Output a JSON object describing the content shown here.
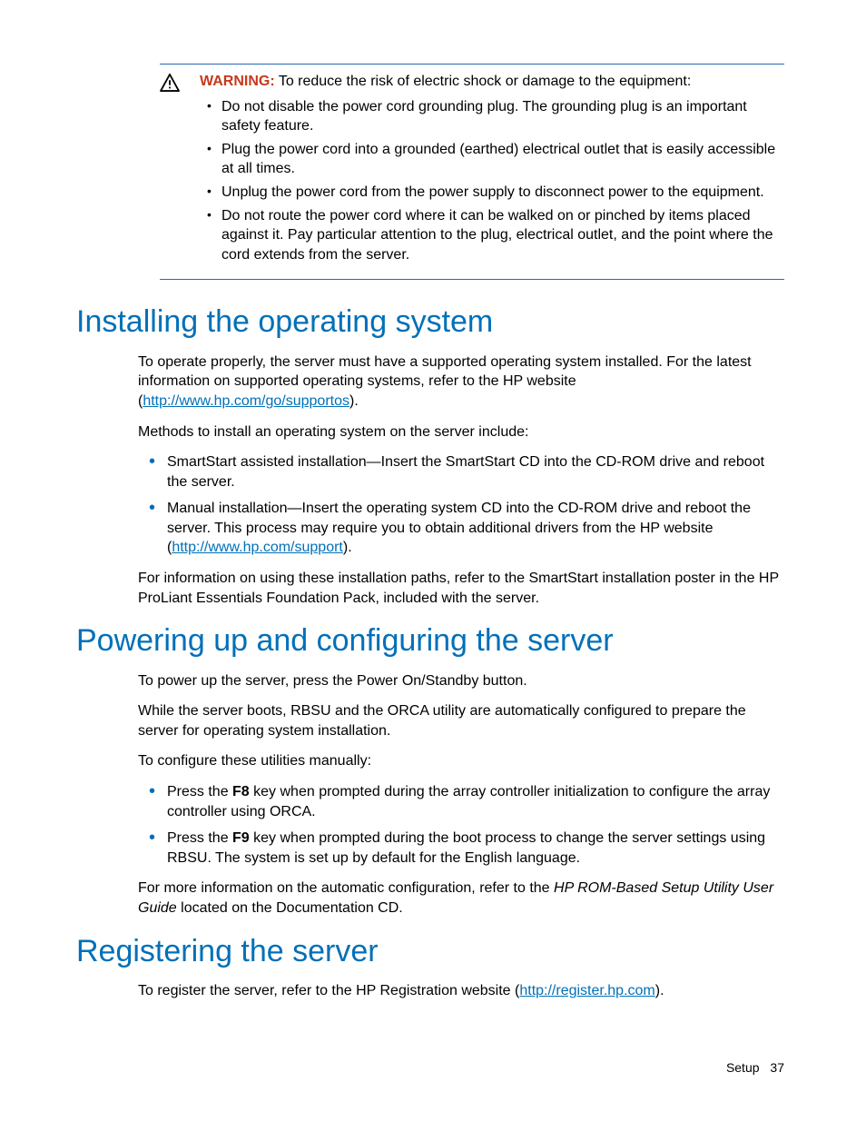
{
  "warning": {
    "label": "WARNING:",
    "intro": "To reduce the risk of electric shock or damage to the equipment:",
    "items": [
      "Do not disable the power cord grounding plug. The grounding plug is an important safety feature.",
      "Plug the power cord into a grounded (earthed) electrical outlet that is easily accessible at all times.",
      "Unplug the power cord from the power supply to disconnect power to the equipment.",
      "Do not route the power cord where it can be walked on or pinched by items placed against it. Pay particular attention to the plug, electrical outlet, and the point where the cord extends from the server."
    ]
  },
  "sections": {
    "install": {
      "heading": "Installing the operating system",
      "p1a": "To operate properly, the server must have a supported operating system installed. For the latest information on supported operating systems, refer to the HP website (",
      "link1": "http://www.hp.com/go/supportos",
      "p1b": ").",
      "p2": "Methods to install an operating system on the server include:",
      "bullets": {
        "b1": "SmartStart assisted installation—Insert the SmartStart CD into the CD-ROM drive and reboot the server.",
        "b2a": "Manual installation—Insert the operating system CD into the CD-ROM drive and reboot the server. This process may require you to obtain additional drivers from the HP website (",
        "b2link": "http://www.hp.com/support",
        "b2b": ")."
      },
      "p3": "For information on using these installation paths, refer to the SmartStart installation poster in the HP ProLiant Essentials Foundation Pack, included with the server."
    },
    "power": {
      "heading": "Powering up and configuring the server",
      "p1": "To power up the server, press the Power On/Standby button.",
      "p2": "While the server boots, RBSU and the ORCA utility are automatically configured to prepare the server for operating system installation.",
      "p3": "To configure these utilities manually:",
      "bullets": {
        "b1a": "Press the ",
        "b1key": "F8",
        "b1b": " key when prompted during the array controller initialization to configure the array controller using ORCA.",
        "b2a": "Press the ",
        "b2key": "F9",
        "b2b": " key when prompted during the boot process to change the server settings using RBSU. The system is set up by default for the English language."
      },
      "p4a": "For more information on the automatic configuration, refer to the ",
      "p4i": "HP ROM-Based Setup Utility User Guide",
      "p4b": " located on the Documentation CD."
    },
    "register": {
      "heading": "Registering the server",
      "p1a": "To register the server, refer to the HP Registration website (",
      "link": "http://register.hp.com",
      "p1b": ")."
    }
  },
  "footer": {
    "section": "Setup",
    "page": "37"
  }
}
